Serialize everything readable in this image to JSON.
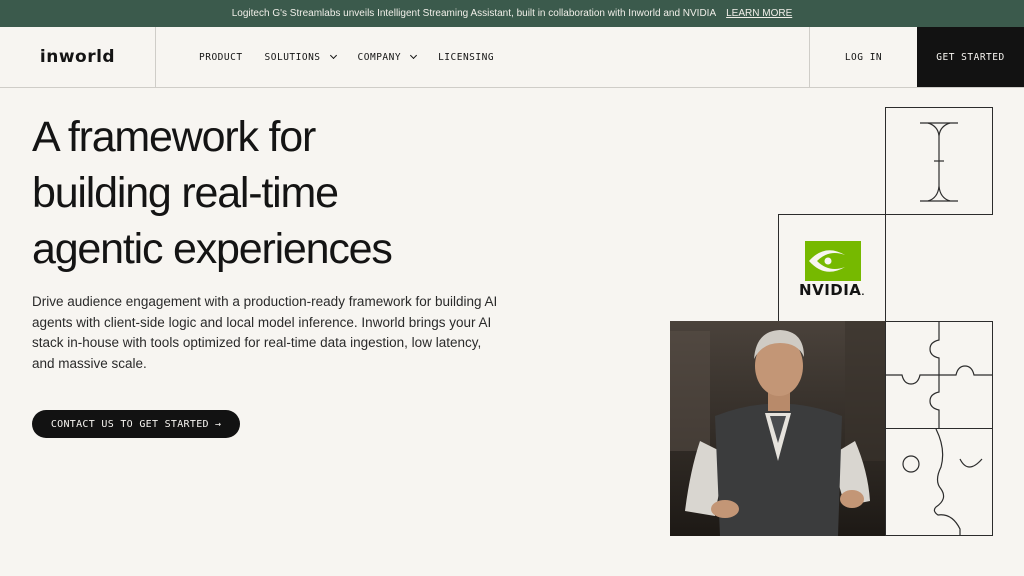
{
  "banner": {
    "text": "Logitech G's Streamlabs unveils Intelligent Streaming Assistant, built in collaboration with Inworld and NVIDIA",
    "link": "LEARN MORE"
  },
  "nav": {
    "logo": "inworld",
    "items": [
      {
        "label": "PRODUCT",
        "has_dropdown": false
      },
      {
        "label": "SOLUTIONS",
        "has_dropdown": true
      },
      {
        "label": "COMPANY",
        "has_dropdown": true
      },
      {
        "label": "LICENSING",
        "has_dropdown": false
      }
    ],
    "login": "LOG IN",
    "get_started": "GET STARTED"
  },
  "hero": {
    "title_lines": [
      "A framework for",
      "building real-time",
      "agentic experiences"
    ],
    "description": "Drive audience engagement with a production-ready framework for building AI agents with client-side logic and local model inference. Inworld brings your AI stack in-house with tools optimized for real-time data ingestion, low latency, and massive scale.",
    "cta": "CONTACT US TO GET STARTED",
    "cta_arrow": "→"
  },
  "tiles": {
    "partner_logo": "NVIDIA",
    "partner_suffix": ".",
    "icons": [
      "text-cursor-icon",
      "nvidia-logo",
      "puzzle-icon",
      "face-profile-icon"
    ]
  },
  "colors": {
    "banner_bg": "#3b5a4c",
    "page_bg": "#f7f5f1",
    "dark": "#121212",
    "nvidia_green": "#76b900"
  }
}
